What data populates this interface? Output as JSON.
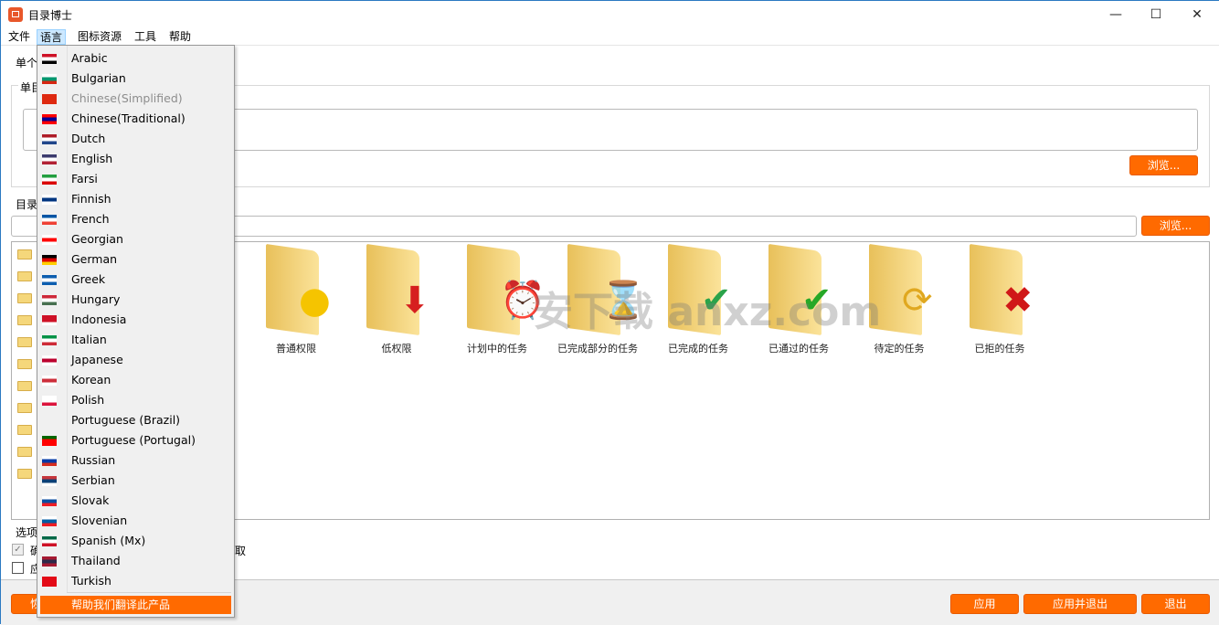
{
  "window": {
    "title": "目录博士",
    "controls": [
      "minimize",
      "maximize",
      "close"
    ]
  },
  "menubar": [
    "文件",
    "语言",
    "图标资源",
    "工具",
    "帮助"
  ],
  "active_menu": "语言",
  "main": {
    "single_label": "单个",
    "single_group_label": "单目",
    "browse_label": "浏览...",
    "dir_label": "目录",
    "options_label": "选项",
    "option1_partial": "确",
    "option1_checked": true,
    "option2_partial": "应",
    "option2_checked": false,
    "option_trailing": "取",
    "bottom_left_partial": "恢",
    "apply": "应用",
    "apply_exit": "应用并退出",
    "exit": "退出",
    "folders": [
      {
        "label": "普通权限",
        "overlay": "yellow-circle"
      },
      {
        "label": "低权限",
        "overlay": "red-down-arrow"
      },
      {
        "label": "计划中的任务",
        "overlay": "alarm-clock"
      },
      {
        "label": "已完成部分的任务",
        "overlay": "hourglass"
      },
      {
        "label": "已完成的任务",
        "overlay": "clipboard-shield"
      },
      {
        "label": "已通过的任务",
        "overlay": "green-check"
      },
      {
        "label": "待定的任务",
        "overlay": "refresh-arrows"
      },
      {
        "label": "已拒的任务",
        "overlay": "red-x"
      }
    ],
    "watermark": "安下载 anxz.com"
  },
  "language_menu": {
    "items": [
      {
        "label": "Arabic",
        "flag": [
          "#ce1126",
          "#ffffff",
          "#000000"
        ]
      },
      {
        "label": "Bulgarian",
        "flag": [
          "#ffffff",
          "#00966e",
          "#d62612"
        ]
      },
      {
        "label": "Chinese(Simplified)",
        "flag": [
          "#de2910",
          "#de2910",
          "#de2910"
        ],
        "disabled": true
      },
      {
        "label": "Chinese(Traditional)",
        "flag": [
          "#fe0000",
          "#000095",
          "#fe0000"
        ]
      },
      {
        "label": "Dutch",
        "flag": [
          "#ae1c28",
          "#ffffff",
          "#21468b"
        ]
      },
      {
        "label": "English",
        "flag": [
          "#3c3b6e",
          "#ffffff",
          "#b22234"
        ]
      },
      {
        "label": "Farsi",
        "flag": [
          "#239f40",
          "#ffffff",
          "#da0000"
        ]
      },
      {
        "label": "Finnish",
        "flag": [
          "#ffffff",
          "#003580",
          "#ffffff"
        ]
      },
      {
        "label": "French",
        "flag": [
          "#0055a4",
          "#ffffff",
          "#ef4135"
        ]
      },
      {
        "label": "Georgian",
        "flag": [
          "#ffffff",
          "#ff0000",
          "#ffffff"
        ]
      },
      {
        "label": "German",
        "flag": [
          "#000000",
          "#dd0000",
          "#ffce00"
        ]
      },
      {
        "label": "Greek",
        "flag": [
          "#0d5eaf",
          "#ffffff",
          "#0d5eaf"
        ]
      },
      {
        "label": "Hungary",
        "flag": [
          "#ce2939",
          "#ffffff",
          "#477050"
        ]
      },
      {
        "label": "Indonesia",
        "flag": [
          "#ce1126",
          "#ce1126",
          "#ffffff"
        ]
      },
      {
        "label": "Italian",
        "flag": [
          "#009246",
          "#ffffff",
          "#ce2b37"
        ]
      },
      {
        "label": "Japanese",
        "flag": [
          "#ffffff",
          "#bc002d",
          "#ffffff"
        ]
      },
      {
        "label": "Korean",
        "flag": [
          "#ffffff",
          "#cd2e3a",
          "#ffffff"
        ]
      },
      {
        "label": "Polish",
        "flag": [
          "#ffffff",
          "#ffffff",
          "#dc143c"
        ]
      },
      {
        "label": "Portuguese (Brazil)",
        "flag": [
          "#f0f0f0",
          "#f0f0f0",
          "#f0f0f0"
        ]
      },
      {
        "label": "Portuguese (Portugal)",
        "flag": [
          "#006600",
          "#ff0000",
          "#ff0000"
        ]
      },
      {
        "label": "Russian",
        "flag": [
          "#ffffff",
          "#0039a6",
          "#d52b1e"
        ]
      },
      {
        "label": "Serbian",
        "flag": [
          "#c6363c",
          "#0c4076",
          "#ffffff"
        ]
      },
      {
        "label": "Slovak",
        "flag": [
          "#ffffff",
          "#0b4ea2",
          "#ee1c25"
        ]
      },
      {
        "label": "Slovenian",
        "flag": [
          "#ffffff",
          "#005da4",
          "#ed1c24"
        ]
      },
      {
        "label": "Spanish (Mx)",
        "flag": [
          "#006847",
          "#ffffff",
          "#ce1126"
        ]
      },
      {
        "label": "Thailand",
        "flag": [
          "#a51931",
          "#2d2a4a",
          "#a51931"
        ]
      },
      {
        "label": "Turkish",
        "flag": [
          "#e30a17",
          "#e30a17",
          "#e30a17"
        ]
      }
    ],
    "help_translate": "帮助我们翻译此产品"
  },
  "colors": {
    "accent": "#ff6a00",
    "menu_highlight": "#cce8ff"
  }
}
